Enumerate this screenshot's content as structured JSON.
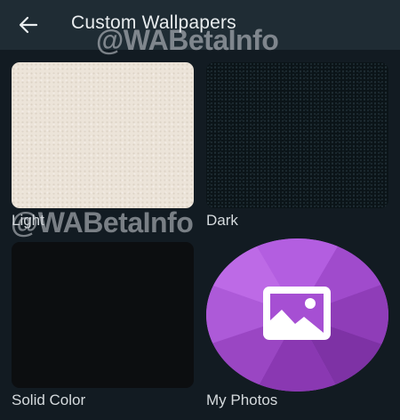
{
  "header": {
    "title": "Custom Wallpapers",
    "back_icon": "arrow-back-icon"
  },
  "watermark": "@WABetaInfo",
  "tiles": [
    {
      "label": "Light",
      "color": "#ece4d9"
    },
    {
      "label": "Dark",
      "color": "#0b1418"
    },
    {
      "label": "Solid Color",
      "color": "#0c0e10"
    },
    {
      "label": "My Photos",
      "color": "#9b43c8",
      "icon": "image-icon"
    }
  ],
  "colors": {
    "app_bar": "#1f2c34",
    "background": "#121b22",
    "text": "#e9edef"
  }
}
